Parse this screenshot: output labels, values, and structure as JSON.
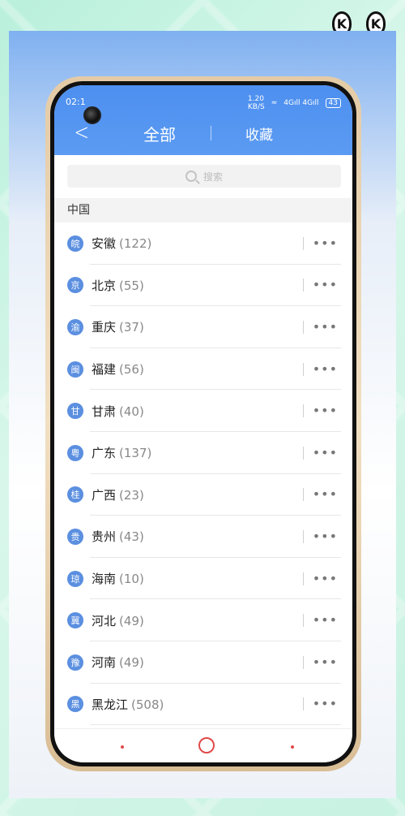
{
  "status": {
    "time": "02:1",
    "speed_top": "1.20",
    "speed_bottom": "KB/S",
    "signals": "4Gıll 4Gıll",
    "battery": "43"
  },
  "nav": {
    "tab_all": "全部",
    "tab_favorites": "收藏"
  },
  "search": {
    "placeholder": "搜索"
  },
  "section": {
    "title": "中国"
  },
  "provinces": [
    {
      "badge": "皖",
      "name": "安徽",
      "count": "(122)"
    },
    {
      "badge": "京",
      "name": "北京",
      "count": "(55)"
    },
    {
      "badge": "渝",
      "name": "重庆",
      "count": "(37)"
    },
    {
      "badge": "闽",
      "name": "福建",
      "count": "(56)"
    },
    {
      "badge": "甘",
      "name": "甘肃",
      "count": "(40)"
    },
    {
      "badge": "粤",
      "name": "广东",
      "count": "(137)"
    },
    {
      "badge": "桂",
      "name": "广西",
      "count": "(23)"
    },
    {
      "badge": "贵",
      "name": "贵州",
      "count": "(43)"
    },
    {
      "badge": "琼",
      "name": "海南",
      "count": "(10)"
    },
    {
      "badge": "冀",
      "name": "河北",
      "count": "(49)"
    },
    {
      "badge": "豫",
      "name": "河南",
      "count": "(49)"
    },
    {
      "badge": "黑",
      "name": "黑龙江",
      "count": "(508)"
    }
  ],
  "more_glyph": "•••",
  "colors": {
    "header": "#4d8ff0",
    "badge": "#5b8fe0",
    "accent": "#e04a4a"
  }
}
